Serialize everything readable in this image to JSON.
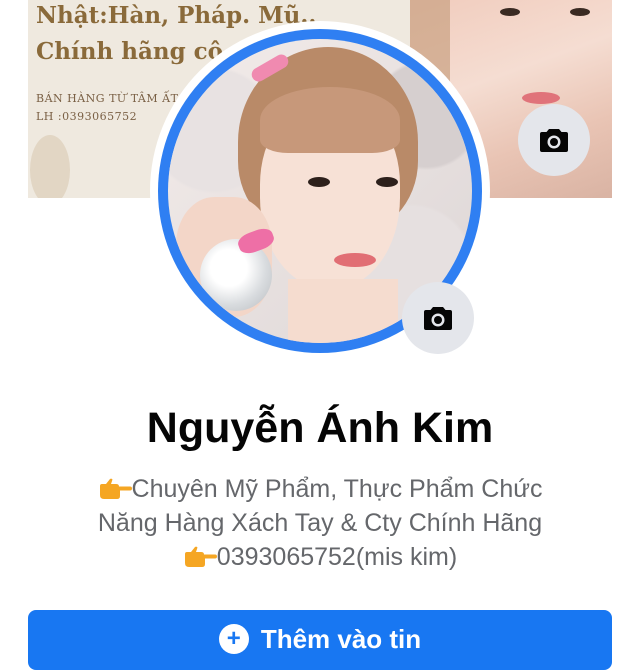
{
  "cover": {
    "line1": "Nhật:Hàn, Pháp. Mũ..",
    "line2": "Chính hãng cô",
    "small1": "BÁN HÀNG TỪ TÂM ẤT",
    "small2": "LH :0393065752"
  },
  "profile": {
    "name": "Nguyễn Ánh Kim",
    "bio_lines": [
      "Chuyên Mỹ Phẩm, Thực Phẩm Chức",
      "Năng Hàng Xách Tay & Cty Chính Hãng",
      "0393065752(mis kim)"
    ],
    "bio_icon": "pointing-hand-icon"
  },
  "actions": {
    "add_story_label": "Thêm vào tin",
    "cover_camera_icon": "camera-icon",
    "avatar_camera_icon": "camera-icon"
  },
  "colors": {
    "accent": "#1877f2",
    "avatar_ring": "#2f7ff2",
    "bio_text": "#65676b",
    "name_text": "#050505",
    "camera_button_bg": "#e4e6eb"
  }
}
